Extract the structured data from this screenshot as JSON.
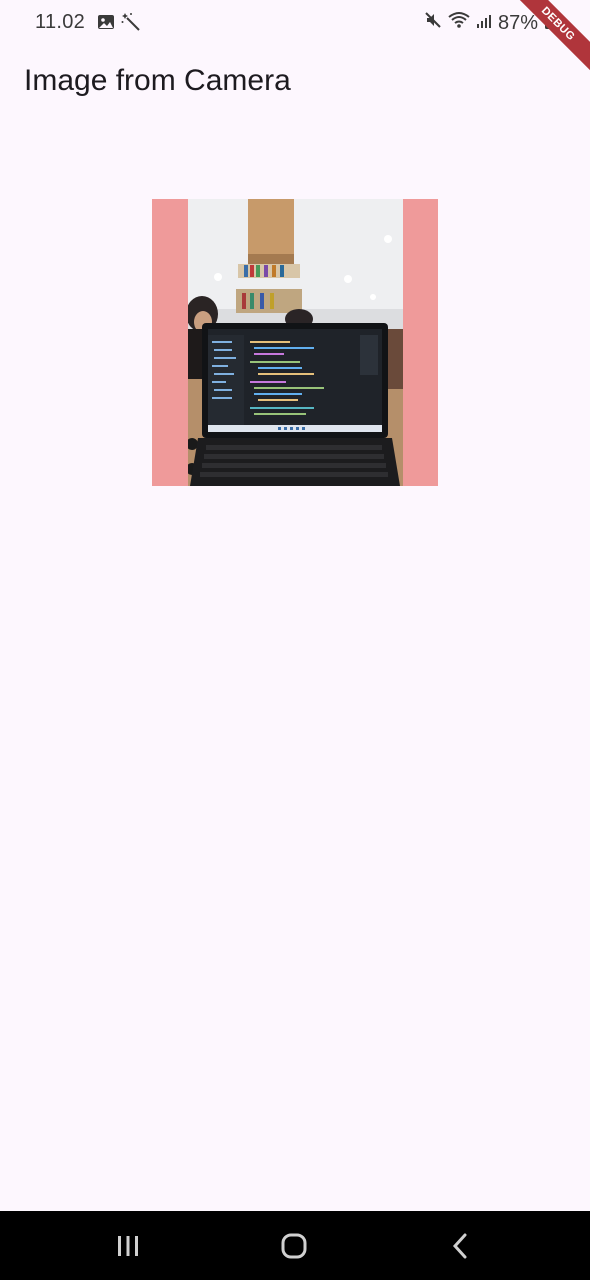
{
  "status_bar": {
    "time": "11.02",
    "battery": "87%",
    "icons": [
      "image-icon",
      "magic-wand-icon",
      "mute-icon",
      "wifi-icon",
      "signal-icon",
      "battery-icon"
    ]
  },
  "debug_banner": {
    "label": "DEBUG",
    "color": "#b0353b"
  },
  "app_bar": {
    "title": "Image from Camera"
  },
  "main": {
    "photo_background": "#ef9a9a"
  },
  "nav_bar": {
    "buttons": [
      "recent-apps",
      "home",
      "back"
    ]
  },
  "colors": {
    "background": "#fdf7fe",
    "nav": "#000000"
  }
}
